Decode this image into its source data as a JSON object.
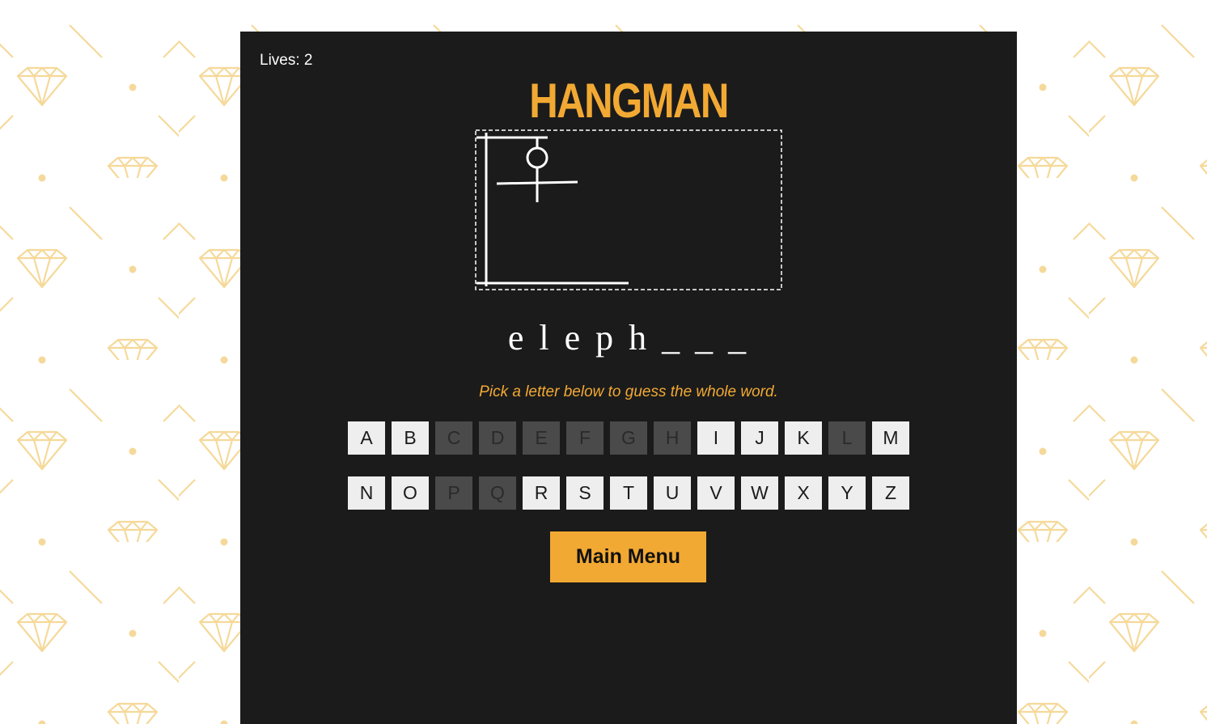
{
  "game": {
    "lives_label": "Lives: 2",
    "title": "HANGMAN",
    "word_display": "e l e p h _ _ _",
    "hint": "Pick a letter below to guess the whole word.",
    "main_menu_label": "Main Menu"
  },
  "keyboard": {
    "row1": [
      {
        "letter": "A",
        "used": false
      },
      {
        "letter": "B",
        "used": false
      },
      {
        "letter": "C",
        "used": true
      },
      {
        "letter": "D",
        "used": true
      },
      {
        "letter": "E",
        "used": true
      },
      {
        "letter": "F",
        "used": true
      },
      {
        "letter": "G",
        "used": true
      },
      {
        "letter": "H",
        "used": true
      },
      {
        "letter": "I",
        "used": false
      },
      {
        "letter": "J",
        "used": false
      },
      {
        "letter": "K",
        "used": false
      },
      {
        "letter": "L",
        "used": true
      },
      {
        "letter": "M",
        "used": false
      }
    ],
    "row2": [
      {
        "letter": "N",
        "used": false
      },
      {
        "letter": "O",
        "used": false
      },
      {
        "letter": "P",
        "used": true
      },
      {
        "letter": "Q",
        "used": true
      },
      {
        "letter": "R",
        "used": false
      },
      {
        "letter": "S",
        "used": false
      },
      {
        "letter": "T",
        "used": false
      },
      {
        "letter": "U",
        "used": false
      },
      {
        "letter": "V",
        "used": false
      },
      {
        "letter": "W",
        "used": false
      },
      {
        "letter": "X",
        "used": false
      },
      {
        "letter": "Y",
        "used": false
      },
      {
        "letter": "Z",
        "used": false
      }
    ]
  },
  "hangman_drawing": {
    "parts_shown": [
      "gallows-base",
      "gallows-post",
      "gallows-beam",
      "rope",
      "head",
      "arms",
      "torso"
    ]
  },
  "colors": {
    "accent": "#f2a933",
    "panel": "#1b1b1b",
    "key": "#eeeeee",
    "key_used": "#4a4a4a",
    "pattern": "#f5d99a"
  }
}
